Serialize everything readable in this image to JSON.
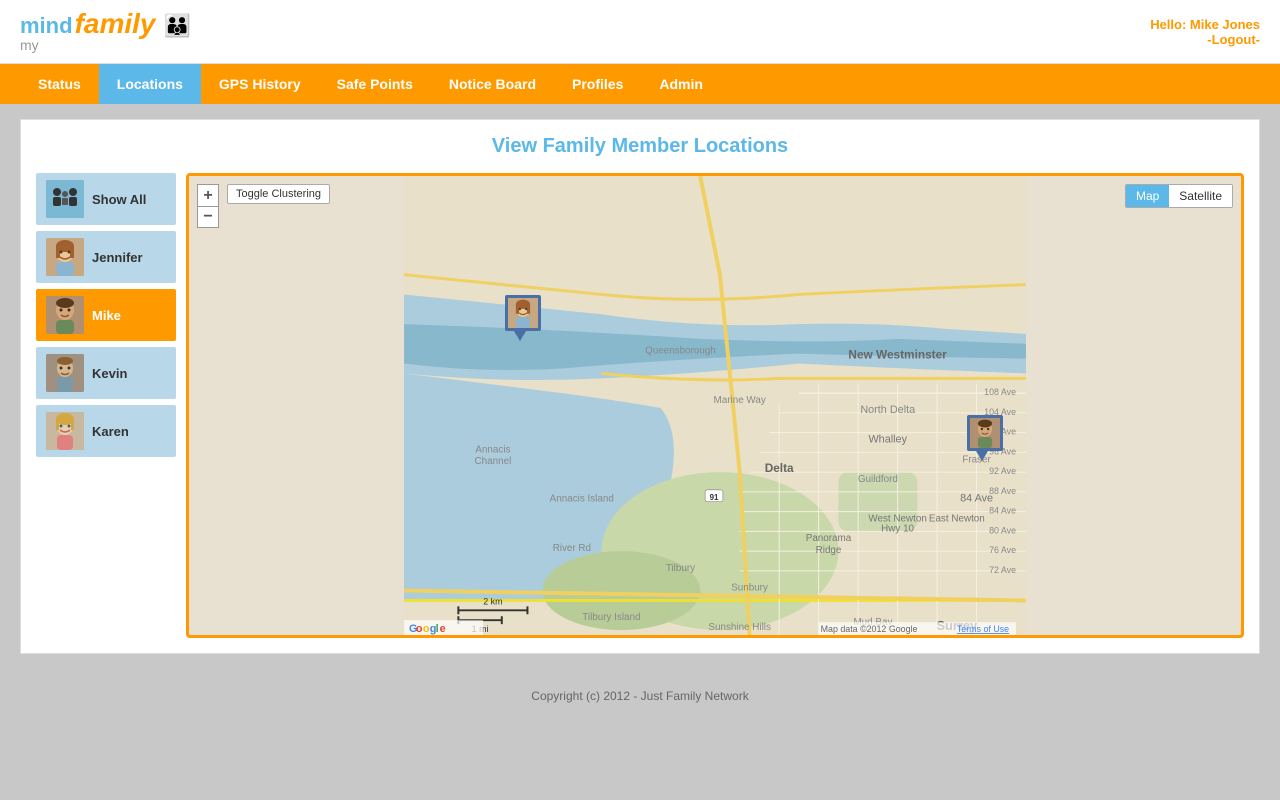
{
  "header": {
    "logo_mind": "mind",
    "logo_my": "my",
    "logo_family": "family",
    "greeting": "Hello: Mike Jones",
    "logout": "-Logout-"
  },
  "nav": {
    "items": [
      {
        "id": "status",
        "label": "Status",
        "active": false
      },
      {
        "id": "locations",
        "label": "Locations",
        "active": true
      },
      {
        "id": "gps-history",
        "label": "GPS History",
        "active": false
      },
      {
        "id": "safe-points",
        "label": "Safe Points",
        "active": false
      },
      {
        "id": "notice-board",
        "label": "Notice Board",
        "active": false
      },
      {
        "id": "profiles",
        "label": "Profiles",
        "active": false
      },
      {
        "id": "admin",
        "label": "Admin",
        "active": false
      }
    ]
  },
  "page": {
    "title": "View Family Member Locations"
  },
  "sidebar": {
    "members": [
      {
        "id": "show-all",
        "name": "Show All",
        "active": false,
        "has_icon": true
      },
      {
        "id": "jennifer",
        "name": "Jennifer",
        "active": false,
        "has_icon": false
      },
      {
        "id": "mike",
        "name": "Mike",
        "active": true,
        "has_icon": false
      },
      {
        "id": "kevin",
        "name": "Kevin",
        "active": false,
        "has_icon": false
      },
      {
        "id": "karen",
        "name": "Karen",
        "active": false,
        "has_icon": false
      }
    ]
  },
  "map": {
    "toggle_clustering": "Toggle Clustering",
    "type_map": "Map",
    "type_satellite": "Satellite",
    "zoom_in": "+",
    "zoom_out": "−",
    "attribution": "Map data ©2012 Google",
    "terms": "Terms of Use",
    "scale_2km": "2 km",
    "scale_1mi": "1 mi",
    "markers": [
      {
        "id": "jennifer-marker",
        "x": 30,
        "y": 27
      },
      {
        "id": "mike-marker",
        "x": 57,
        "y": 56
      }
    ]
  },
  "footer": {
    "text": "Copyright (c) 2012 - Just Family Network"
  }
}
